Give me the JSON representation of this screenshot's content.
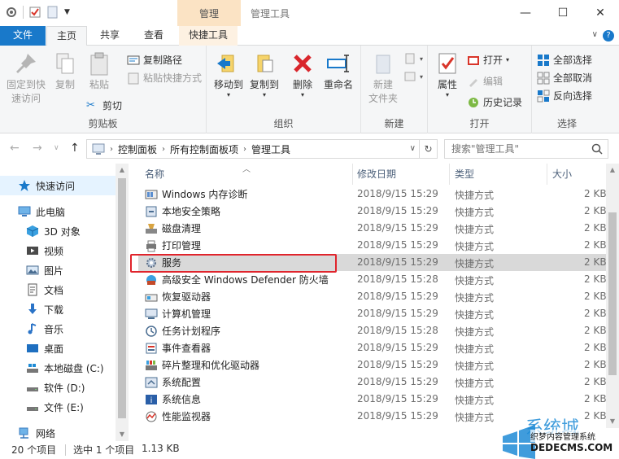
{
  "window": {
    "context_tab_header": "管理",
    "title": "管理工具",
    "controls": {
      "minimize": "—",
      "maximize": "☐",
      "close": "✕"
    }
  },
  "ribbon_tabs": [
    {
      "label": "文件"
    },
    {
      "label": "主页"
    },
    {
      "label": "共享"
    },
    {
      "label": "查看"
    },
    {
      "label": "快捷工具"
    }
  ],
  "ribbon": {
    "clipboard": {
      "label": "剪贴板",
      "pin_line1": "固定到快",
      "pin_line2": "速访问",
      "copy": "复制",
      "paste": "粘贴",
      "copy_path": "复制路径",
      "paste_shortcut": "粘贴快捷方式",
      "cut": "剪切"
    },
    "organize": {
      "label": "组织",
      "move_to": "移动到",
      "copy_to": "复制到",
      "delete": "删除",
      "rename": "重命名"
    },
    "new": {
      "label": "新建",
      "new_folder_line1": "新建",
      "new_folder_line2": "文件夹"
    },
    "open": {
      "label": "打开",
      "properties": "属性",
      "open": "打开",
      "edit": "编辑",
      "history": "历史记录"
    },
    "select": {
      "label": "选择",
      "select_all": "全部选择",
      "select_none": "全部取消",
      "invert": "反向选择"
    }
  },
  "address": {
    "crumbs": [
      "控制面板",
      "所有控制面板项",
      "管理工具"
    ],
    "search_placeholder": "搜索\"管理工具\""
  },
  "nav": {
    "quick_access": "快速访问",
    "this_pc": "此电脑",
    "items": [
      {
        "label": "3D 对象"
      },
      {
        "label": "视频"
      },
      {
        "label": "图片"
      },
      {
        "label": "文档"
      },
      {
        "label": "下载"
      },
      {
        "label": "音乐"
      },
      {
        "label": "桌面"
      },
      {
        "label": "本地磁盘 (C:)"
      },
      {
        "label": "软件 (D:)"
      },
      {
        "label": "文件 (E:)"
      }
    ],
    "network": "网络"
  },
  "columns": {
    "name": "名称",
    "date": "修改日期",
    "type": "类型",
    "size": "大小"
  },
  "files": [
    {
      "name": "Windows 内存诊断",
      "date": "2018/9/15 15:29",
      "type": "快捷方式",
      "size": "2 KB"
    },
    {
      "name": "本地安全策略",
      "date": "2018/9/15 15:29",
      "type": "快捷方式",
      "size": "2 KB"
    },
    {
      "name": "磁盘清理",
      "date": "2018/9/15 15:29",
      "type": "快捷方式",
      "size": "2 KB"
    },
    {
      "name": "打印管理",
      "date": "2018/9/15 15:29",
      "type": "快捷方式",
      "size": "2 KB"
    },
    {
      "name": "服务",
      "date": "2018/9/15 15:29",
      "type": "快捷方式",
      "size": "2 KB"
    },
    {
      "name": "高级安全 Windows Defender 防火墙",
      "date": "2018/9/15 15:28",
      "type": "快捷方式",
      "size": "2 KB"
    },
    {
      "name": "恢复驱动器",
      "date": "2018/9/15 15:29",
      "type": "快捷方式",
      "size": "2 KB"
    },
    {
      "name": "计算机管理",
      "date": "2018/9/15 15:29",
      "type": "快捷方式",
      "size": "2 KB"
    },
    {
      "name": "任务计划程序",
      "date": "2018/9/15 15:28",
      "type": "快捷方式",
      "size": "2 KB"
    },
    {
      "name": "事件查看器",
      "date": "2018/9/15 15:29",
      "type": "快捷方式",
      "size": "2 KB"
    },
    {
      "name": "碎片整理和优化驱动器",
      "date": "2018/9/15 15:29",
      "type": "快捷方式",
      "size": "2 KB"
    },
    {
      "name": "系统配置",
      "date": "2018/9/15 15:29",
      "type": "快捷方式",
      "size": "2 KB"
    },
    {
      "name": "系统信息",
      "date": "2018/9/15 15:29",
      "type": "快捷方式",
      "size": "2 KB"
    },
    {
      "name": "性能监视器",
      "date": "2018/9/15 15:29",
      "type": "快捷方式",
      "size": "2 KB"
    }
  ],
  "status": {
    "count": "20 个项目",
    "selected": "选中 1 个项目",
    "size": "1.13 KB"
  },
  "watermark": {
    "brand": "系统城",
    "line1": "织梦内容管理系统",
    "line2": "DEDECMS.COM"
  },
  "colors": {
    "file_tab": "#1979ca",
    "context_tab": "#fbe3c4",
    "highlight_box": "#e0242c",
    "selected_row": "#d9d9d9"
  }
}
